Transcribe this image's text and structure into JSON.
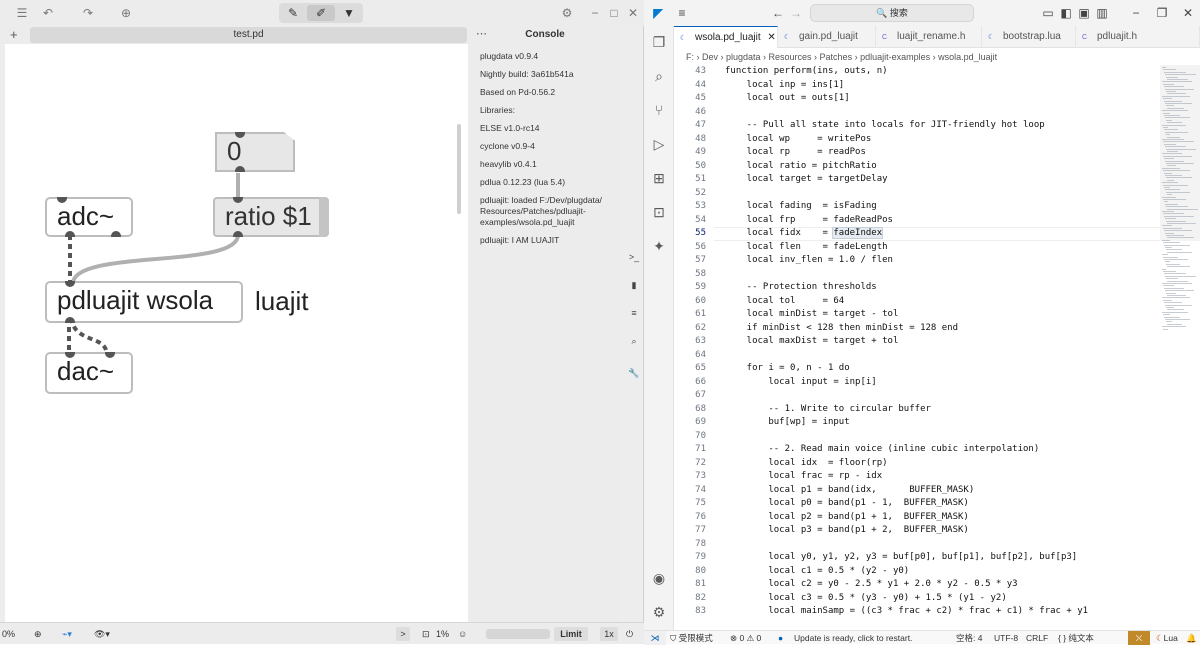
{
  "pd": {
    "toolbar": {
      "undo_icon": "↶",
      "redo_icon": "↷",
      "add_icon": "⊕",
      "edit_icon": "✎",
      "run_icon": "✐",
      "present_icon": "▼",
      "settings_icon": "⚙",
      "minimize": "−",
      "maximize": "□",
      "close": "✕"
    },
    "tab": {
      "title": "test.pd",
      "plus": "+",
      "more": "⋯"
    },
    "objects": {
      "number": "0",
      "adc": "adc~",
      "ratio": "ratio $1",
      "pdluajit": "pdluajit wsola",
      "dac": "dac~",
      "comment": "luajit"
    },
    "console": {
      "title": "Console",
      "lines": [
        "plugdata v0.9.4",
        "Nightly build: 3a61b541a",
        "Based on Pd-0.56.2",
        "Libraries:",
        "ELSE v1.0-rc14",
        "cyclone v0.9-4",
        "heavylib v0.4.1",
        "pdlua 0.12.23 (lua 5.4)",
        "pdluajit: loaded F:/Dev/plugdata/ Resources/Patches/pdluajit- examples/wsola.pd_luajit",
        "pdluajit: I AM LUAJIT"
      ]
    },
    "status": {
      "zoom": "0%",
      "arrow": ">",
      "cpu": "1%",
      "limit": "Limit",
      "oversample": "1x"
    }
  },
  "vscode": {
    "search_text": "🔍 搜索",
    "tabs": [
      "wsola.pd_luajit",
      "gain.pd_luajit",
      "luajit_rename.h",
      "bootstrap.lua",
      "pdluajit.h"
    ],
    "breadcrumb": "F: › Dev › plugdata › Resources › Patches › pdluajit-examples › wsola.pd_luajit",
    "current_line": 55,
    "highlight_word": "fadeIndex",
    "lines": [
      {
        "n": 43,
        "t": "function perform(ins, outs, n)"
      },
      {
        "n": 44,
        "t": "    local inp = ins[1]"
      },
      {
        "n": 45,
        "t": "    local out = outs[1]"
      },
      {
        "n": 46,
        "t": ""
      },
      {
        "n": 47,
        "t": "    -- Pull all state into locals for JIT-friendly hot loop"
      },
      {
        "n": 48,
        "t": "    local wp     = writePos"
      },
      {
        "n": 49,
        "t": "    local rp     = readPos"
      },
      {
        "n": 50,
        "t": "    local ratio = pitchRatio"
      },
      {
        "n": 51,
        "t": "    local target = targetDelay"
      },
      {
        "n": 52,
        "t": ""
      },
      {
        "n": 53,
        "t": "    local fading  = isFading"
      },
      {
        "n": 54,
        "t": "    local frp     = fadeReadPos"
      },
      {
        "n": 55,
        "t": "    local fidx    = fadeIndex"
      },
      {
        "n": 56,
        "t": "    local flen    = fadeLength"
      },
      {
        "n": 57,
        "t": "    local inv_flen = 1.0 / flen"
      },
      {
        "n": 58,
        "t": ""
      },
      {
        "n": 59,
        "t": "    -- Protection thresholds"
      },
      {
        "n": 60,
        "t": "    local tol     = 64"
      },
      {
        "n": 61,
        "t": "    local minDist = target - tol"
      },
      {
        "n": 62,
        "t": "    if minDist < 128 then minDist = 128 end"
      },
      {
        "n": 63,
        "t": "    local maxDist = target + tol"
      },
      {
        "n": 64,
        "t": ""
      },
      {
        "n": 65,
        "t": "    for i = 0, n - 1 do"
      },
      {
        "n": 66,
        "t": "        local input = inp[i]"
      },
      {
        "n": 67,
        "t": ""
      },
      {
        "n": 68,
        "t": "        -- 1. Write to circular buffer"
      },
      {
        "n": 69,
        "t": "        buf[wp] = input"
      },
      {
        "n": 70,
        "t": ""
      },
      {
        "n": 71,
        "t": "        -- 2. Read main voice (inline cubic interpolation)"
      },
      {
        "n": 72,
        "t": "        local idx  = floor(rp)"
      },
      {
        "n": 73,
        "t": "        local frac = rp - idx"
      },
      {
        "n": 74,
        "t": "        local p1 = band(idx,      BUFFER_MASK)"
      },
      {
        "n": 75,
        "t": "        local p0 = band(p1 - 1,  BUFFER_MASK)"
      },
      {
        "n": 76,
        "t": "        local p2 = band(p1 + 1,  BUFFER_MASK)"
      },
      {
        "n": 77,
        "t": "        local p3 = band(p1 + 2,  BUFFER_MASK)"
      },
      {
        "n": 78,
        "t": ""
      },
      {
        "n": 79,
        "t": "        local y0, y1, y2, y3 = buf[p0], buf[p1], buf[p2], buf[p3]"
      },
      {
        "n": 80,
        "t": "        local c1 = 0.5 * (y2 - y0)"
      },
      {
        "n": 81,
        "t": "        local c2 = y0 - 2.5 * y1 + 2.0 * y2 - 0.5 * y3"
      },
      {
        "n": 82,
        "t": "        local c3 = 0.5 * (y3 - y0) + 1.5 * (y1 - y2)"
      },
      {
        "n": 83,
        "t": "        local mainSamp = ((c3 * frac + c2) * frac + c1) * frac + y1"
      }
    ],
    "status": {
      "restricted": "⛉ 受限模式",
      "problems": "⊗ 0 ⚠ 0",
      "update": "Update is ready, click to restart.",
      "spaces": "空格: 4",
      "encoding": "UTF-8",
      "eol": "CRLF",
      "language_mode": "{ } 纯文本",
      "lang": "Lua"
    }
  },
  "colors": {
    "accent": "#005fb8",
    "vs_blue": "#007acc",
    "cable": "#b0b0b0"
  }
}
